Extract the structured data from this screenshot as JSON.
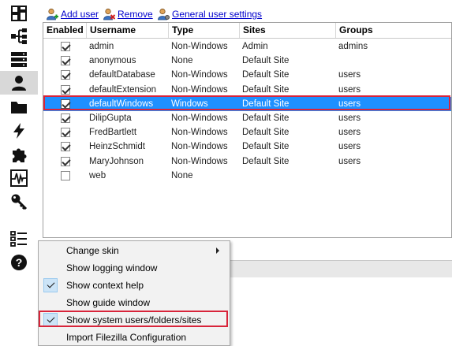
{
  "toolbar": {
    "add_user": "Add user",
    "remove": "Remove",
    "general_settings": "General user settings"
  },
  "sidebar": {
    "items": [
      {
        "icon": "dashboard-icon"
      },
      {
        "icon": "network-icon"
      },
      {
        "icon": "servers-icon"
      },
      {
        "icon": "user-icon",
        "active": true
      },
      {
        "icon": "folder-icon"
      },
      {
        "icon": "lightning-icon"
      },
      {
        "icon": "puzzle-icon"
      },
      {
        "icon": "activity-monitor-icon"
      },
      {
        "icon": "key-icon"
      },
      {
        "icon": "settings-list-icon"
      },
      {
        "icon": "help-icon"
      }
    ]
  },
  "grid": {
    "columns": [
      "Enabled",
      "Username",
      "Type",
      "Sites",
      "Groups"
    ],
    "rows": [
      {
        "enabled": true,
        "username": "admin",
        "type": "Non-Windows",
        "sites": "Admin",
        "groups": "admins"
      },
      {
        "enabled": true,
        "username": "anonymous",
        "type": "None",
        "sites": "Default Site",
        "groups": ""
      },
      {
        "enabled": true,
        "username": "defaultDatabase",
        "type": "Non-Windows",
        "sites": "Default Site",
        "groups": "users"
      },
      {
        "enabled": true,
        "username": "defaultExtension",
        "type": "Non-Windows",
        "sites": "Default Site",
        "groups": "users"
      },
      {
        "enabled": true,
        "username": "defaultWindows",
        "type": "Windows",
        "sites": "Default Site",
        "groups": "users",
        "selected": true
      },
      {
        "enabled": true,
        "username": "DilipGupta",
        "type": "Non-Windows",
        "sites": "Default Site",
        "groups": "users"
      },
      {
        "enabled": true,
        "username": "FredBartlett",
        "type": "Non-Windows",
        "sites": "Default Site",
        "groups": "users"
      },
      {
        "enabled": true,
        "username": "HeinzSchmidt",
        "type": "Non-Windows",
        "sites": "Default Site",
        "groups": "users"
      },
      {
        "enabled": true,
        "username": "MaryJohnson",
        "type": "Non-Windows",
        "sites": "Default Site",
        "groups": "users"
      },
      {
        "enabled": false,
        "username": "web",
        "type": "None",
        "sites": "",
        "groups": ""
      }
    ]
  },
  "context_menu": {
    "items": [
      {
        "label": "Change skin",
        "checked": false,
        "submenu": true
      },
      {
        "label": "Show logging window",
        "checked": false
      },
      {
        "label": "Show context help",
        "checked": true
      },
      {
        "label": "Show guide window",
        "checked": false
      },
      {
        "label": "Show system users/folders/sites",
        "checked": true
      },
      {
        "label": "Import Filezilla Configuration",
        "checked": false
      }
    ]
  },
  "colors": {
    "selection": "#1e90ff",
    "highlight_box": "#d8243a",
    "link": "#0000cc"
  }
}
